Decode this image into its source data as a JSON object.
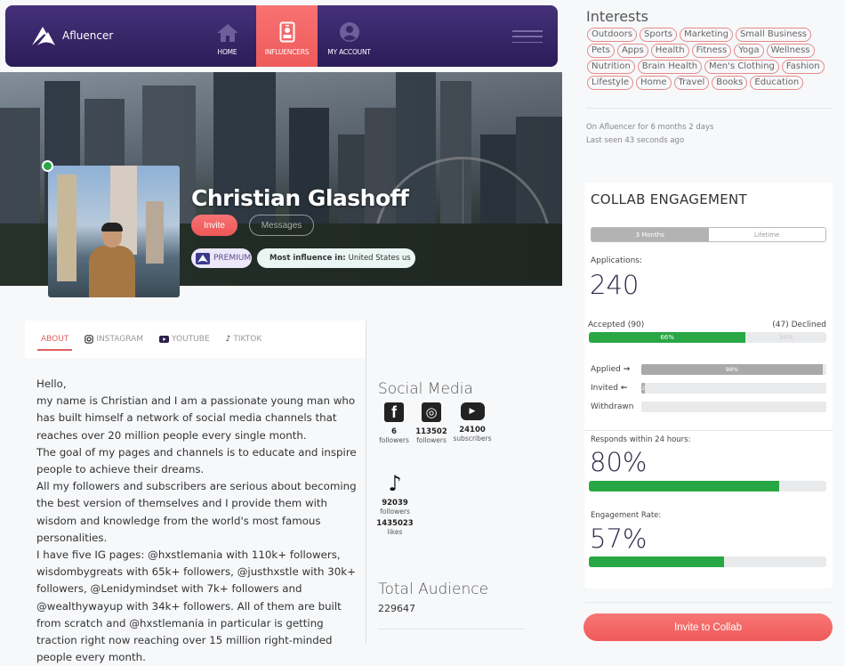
{
  "nav": {
    "brand": "Afluencer",
    "items": [
      {
        "label": "HOME",
        "icon": "home-icon",
        "active": false
      },
      {
        "label": "INFLUENCERS",
        "icon": "id-card-icon",
        "active": true
      },
      {
        "label": "MY ACCOUNT",
        "icon": "user-circle-icon",
        "active": false
      }
    ]
  },
  "profile": {
    "name": "Christian Glashoff",
    "online": true,
    "invite_label": "Invite",
    "messages_label": "Messages",
    "premium_label": "PREMIUM",
    "influence_label": "Most influence in:",
    "influence_value": "United States us"
  },
  "tabs": [
    {
      "label": "ABOUT",
      "icon": "",
      "active": true
    },
    {
      "label": "INSTAGRAM",
      "icon": "instagram-icon",
      "active": false
    },
    {
      "label": "YOUTUBE",
      "icon": "youtube-icon",
      "active": false
    },
    {
      "label": "TIKTOK",
      "icon": "tiktok-icon",
      "active": false
    }
  ],
  "about": {
    "lines": [
      "Hello,",
      "my name is Christian and I am a passionate young man who has built himself a network of social media channels that reaches over 20 million people every single month.",
      "The goal of my pages and channels is to educate and inspire people to achieve their dreams.",
      "All my followers and subscribers are serious about becoming the best version of themselves and I provide them with wisdom and knowledge from the world's most famous personalities.",
      "I have five IG pages: @hxstlemania with 110k+ followers, wisdombygreats with 65k+ followers, @justhxstle with 30k+ followers, @Lenidymindset with 7k+ followers and @wealthywayup with 34k+ followers. All of them are built from scratch and @hxstlemania in particular is getting traction right now reaching over 15 million right-minded people every month."
    ]
  },
  "social": {
    "title": "Social Media",
    "accounts": [
      {
        "platform": "facebook",
        "icon": "facebook-icon",
        "glyph": "f",
        "count": "6",
        "unit": "followers"
      },
      {
        "platform": "instagram",
        "icon": "instagram-icon",
        "glyph": "◎",
        "count": "113502",
        "unit": "followers"
      },
      {
        "platform": "youtube",
        "icon": "youtube-icon",
        "glyph": "▶",
        "count": "24100",
        "unit": "subscribers"
      },
      {
        "platform": "tiktok",
        "icon": "tiktok-icon",
        "glyph": "♪",
        "count": "92039",
        "unit": "followers",
        "count2": "1435023",
        "unit2": "likes"
      }
    ],
    "total_title": "Total Audience",
    "total_value": "229647"
  },
  "interests": {
    "title": "Interests",
    "items": [
      "Outdoors",
      "Sports",
      "Marketing",
      "Small Business",
      "Pets",
      "Apps",
      "Health",
      "Fitness",
      "Yoga",
      "Wellness",
      "Nutrition",
      "Brain Health",
      "Men's Clothing",
      "Fashion",
      "Lifestyle",
      "Home",
      "Travel",
      "Books",
      "Education"
    ],
    "member_since": "On Afluencer for 6 months 2 days",
    "last_seen": "Last seen 43 seconds ago"
  },
  "engagement": {
    "title": "COLLAB ENGAGEMENT",
    "range_options": [
      "3 Months",
      "Lifetime"
    ],
    "range_selected": "3 Months",
    "applications_label": "Applications:",
    "applications_value": "240",
    "accepted_label": "Accepted (90)",
    "declined_label": "(47) Declined",
    "accepted_pct": 66,
    "accepted_pct_label": "66%",
    "declined_pct_label": "34%",
    "sources": [
      {
        "label": "Applied",
        "arrow": "→",
        "pct": 98,
        "pct_label": "98%"
      },
      {
        "label": "Invited",
        "arrow": "←",
        "pct": 2,
        "pct_label": "2"
      },
      {
        "label": "Withdrawn",
        "arrow": "",
        "pct": 0,
        "pct_label": ""
      }
    ],
    "respond_label": "Responds within 24 hours:",
    "respond_value": "80%",
    "respond_pct": 80,
    "engagement_label": "Engagement Rate:",
    "engagement_value": "57%",
    "engagement_pct": 57
  },
  "cta_label": "Invite to Collab",
  "colors": {
    "accent": "#ef5a5a",
    "nav": "#3a2768",
    "success": "#28a745"
  }
}
